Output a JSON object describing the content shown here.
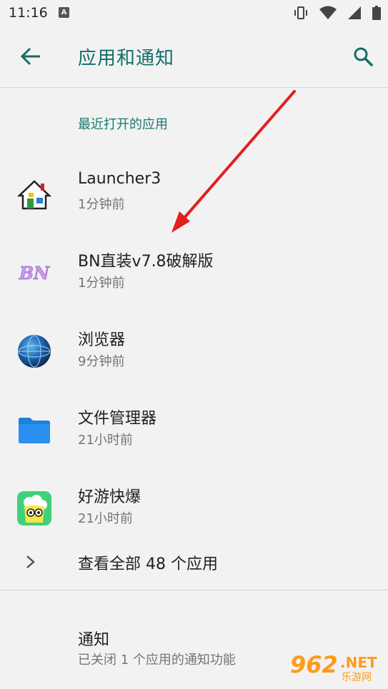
{
  "status_bar": {
    "time": "11:16",
    "notif_glyph": "A"
  },
  "app_bar": {
    "title": "应用和通知"
  },
  "recent": {
    "header": "最近打开的应用",
    "apps": [
      {
        "name": "Launcher3",
        "time": "1分钟前",
        "icon": "house-icon"
      },
      {
        "name": "BN直装v7.8破解版",
        "time": "1分钟前",
        "icon": "bn-logo-icon"
      },
      {
        "name": "浏览器",
        "time": "9分钟前",
        "icon": "globe-icon"
      },
      {
        "name": "文件管理器",
        "time": "21小时前",
        "icon": "folder-icon"
      },
      {
        "name": "好游快爆",
        "time": "21小时前",
        "icon": "haoyou-icon"
      }
    ],
    "see_all": "查看全部 48 个应用"
  },
  "notifications": {
    "title": "通知",
    "summary": "已关闭 1 个应用的通知功能"
  },
  "watermark": {
    "number": "962",
    "suffix": ".NET",
    "subtitle": "乐游网"
  },
  "colors": {
    "accent": "#106f67",
    "background": "#f2f2f2",
    "arrow": "#e02020"
  }
}
